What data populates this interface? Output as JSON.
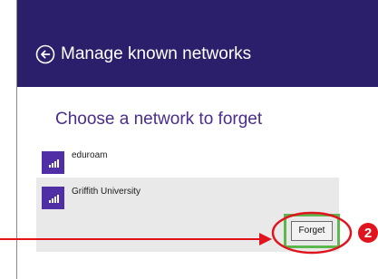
{
  "header": {
    "title": "Manage known networks",
    "back_icon": "back-arrow-circle-icon"
  },
  "section": {
    "title": "Choose a network to forget"
  },
  "networks": [
    {
      "name": "eduroam",
      "icon": "wifi-signal-icon",
      "selected": false
    },
    {
      "name": "Griffith University",
      "icon": "wifi-signal-icon",
      "selected": true
    }
  ],
  "forget_button": {
    "label": "Forget"
  },
  "annotation": {
    "step_number": "2"
  },
  "colors": {
    "header_bg": "#2b1f6b",
    "accent_purple": "#4f2ea6",
    "section_title": "#4a2d8c",
    "selected_bg": "#e9e9e9",
    "annotation_red": "#e0141e",
    "highlight_green": "#5cb84e"
  }
}
